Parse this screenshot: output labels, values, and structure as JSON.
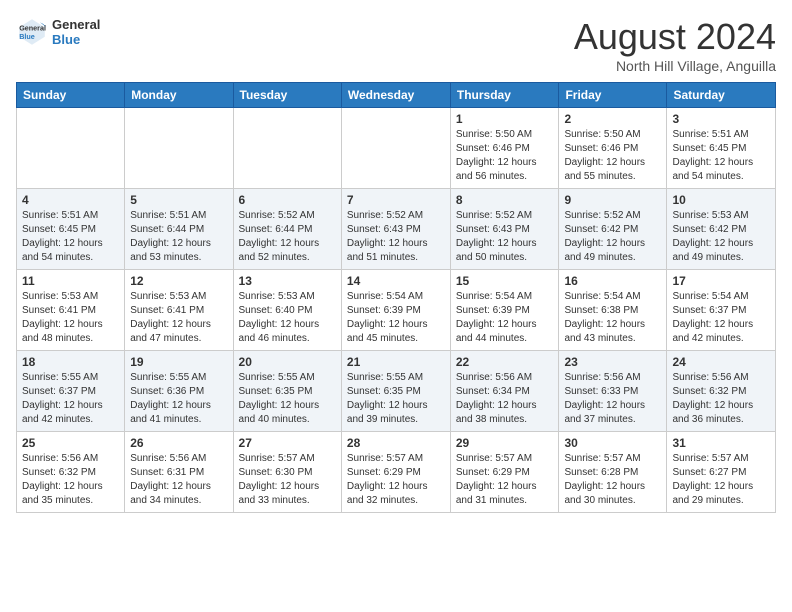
{
  "logo": {
    "general": "General",
    "blue": "Blue"
  },
  "title": {
    "month_year": "August 2024",
    "location": "North Hill Village, Anguilla"
  },
  "days_of_week": [
    "Sunday",
    "Monday",
    "Tuesday",
    "Wednesday",
    "Thursday",
    "Friday",
    "Saturday"
  ],
  "weeks": [
    [
      {
        "day": "",
        "info": ""
      },
      {
        "day": "",
        "info": ""
      },
      {
        "day": "",
        "info": ""
      },
      {
        "day": "",
        "info": ""
      },
      {
        "day": "1",
        "info": "Sunrise: 5:50 AM\nSunset: 6:46 PM\nDaylight: 12 hours\nand 56 minutes."
      },
      {
        "day": "2",
        "info": "Sunrise: 5:50 AM\nSunset: 6:46 PM\nDaylight: 12 hours\nand 55 minutes."
      },
      {
        "day": "3",
        "info": "Sunrise: 5:51 AM\nSunset: 6:45 PM\nDaylight: 12 hours\nand 54 minutes."
      }
    ],
    [
      {
        "day": "4",
        "info": "Sunrise: 5:51 AM\nSunset: 6:45 PM\nDaylight: 12 hours\nand 54 minutes."
      },
      {
        "day": "5",
        "info": "Sunrise: 5:51 AM\nSunset: 6:44 PM\nDaylight: 12 hours\nand 53 minutes."
      },
      {
        "day": "6",
        "info": "Sunrise: 5:52 AM\nSunset: 6:44 PM\nDaylight: 12 hours\nand 52 minutes."
      },
      {
        "day": "7",
        "info": "Sunrise: 5:52 AM\nSunset: 6:43 PM\nDaylight: 12 hours\nand 51 minutes."
      },
      {
        "day": "8",
        "info": "Sunrise: 5:52 AM\nSunset: 6:43 PM\nDaylight: 12 hours\nand 50 minutes."
      },
      {
        "day": "9",
        "info": "Sunrise: 5:52 AM\nSunset: 6:42 PM\nDaylight: 12 hours\nand 49 minutes."
      },
      {
        "day": "10",
        "info": "Sunrise: 5:53 AM\nSunset: 6:42 PM\nDaylight: 12 hours\nand 49 minutes."
      }
    ],
    [
      {
        "day": "11",
        "info": "Sunrise: 5:53 AM\nSunset: 6:41 PM\nDaylight: 12 hours\nand 48 minutes."
      },
      {
        "day": "12",
        "info": "Sunrise: 5:53 AM\nSunset: 6:41 PM\nDaylight: 12 hours\nand 47 minutes."
      },
      {
        "day": "13",
        "info": "Sunrise: 5:53 AM\nSunset: 6:40 PM\nDaylight: 12 hours\nand 46 minutes."
      },
      {
        "day": "14",
        "info": "Sunrise: 5:54 AM\nSunset: 6:39 PM\nDaylight: 12 hours\nand 45 minutes."
      },
      {
        "day": "15",
        "info": "Sunrise: 5:54 AM\nSunset: 6:39 PM\nDaylight: 12 hours\nand 44 minutes."
      },
      {
        "day": "16",
        "info": "Sunrise: 5:54 AM\nSunset: 6:38 PM\nDaylight: 12 hours\nand 43 minutes."
      },
      {
        "day": "17",
        "info": "Sunrise: 5:54 AM\nSunset: 6:37 PM\nDaylight: 12 hours\nand 42 minutes."
      }
    ],
    [
      {
        "day": "18",
        "info": "Sunrise: 5:55 AM\nSunset: 6:37 PM\nDaylight: 12 hours\nand 42 minutes."
      },
      {
        "day": "19",
        "info": "Sunrise: 5:55 AM\nSunset: 6:36 PM\nDaylight: 12 hours\nand 41 minutes."
      },
      {
        "day": "20",
        "info": "Sunrise: 5:55 AM\nSunset: 6:35 PM\nDaylight: 12 hours\nand 40 minutes."
      },
      {
        "day": "21",
        "info": "Sunrise: 5:55 AM\nSunset: 6:35 PM\nDaylight: 12 hours\nand 39 minutes."
      },
      {
        "day": "22",
        "info": "Sunrise: 5:56 AM\nSunset: 6:34 PM\nDaylight: 12 hours\nand 38 minutes."
      },
      {
        "day": "23",
        "info": "Sunrise: 5:56 AM\nSunset: 6:33 PM\nDaylight: 12 hours\nand 37 minutes."
      },
      {
        "day": "24",
        "info": "Sunrise: 5:56 AM\nSunset: 6:32 PM\nDaylight: 12 hours\nand 36 minutes."
      }
    ],
    [
      {
        "day": "25",
        "info": "Sunrise: 5:56 AM\nSunset: 6:32 PM\nDaylight: 12 hours\nand 35 minutes."
      },
      {
        "day": "26",
        "info": "Sunrise: 5:56 AM\nSunset: 6:31 PM\nDaylight: 12 hours\nand 34 minutes."
      },
      {
        "day": "27",
        "info": "Sunrise: 5:57 AM\nSunset: 6:30 PM\nDaylight: 12 hours\nand 33 minutes."
      },
      {
        "day": "28",
        "info": "Sunrise: 5:57 AM\nSunset: 6:29 PM\nDaylight: 12 hours\nand 32 minutes."
      },
      {
        "day": "29",
        "info": "Sunrise: 5:57 AM\nSunset: 6:29 PM\nDaylight: 12 hours\nand 31 minutes."
      },
      {
        "day": "30",
        "info": "Sunrise: 5:57 AM\nSunset: 6:28 PM\nDaylight: 12 hours\nand 30 minutes."
      },
      {
        "day": "31",
        "info": "Sunrise: 5:57 AM\nSunset: 6:27 PM\nDaylight: 12 hours\nand 29 minutes."
      }
    ]
  ]
}
